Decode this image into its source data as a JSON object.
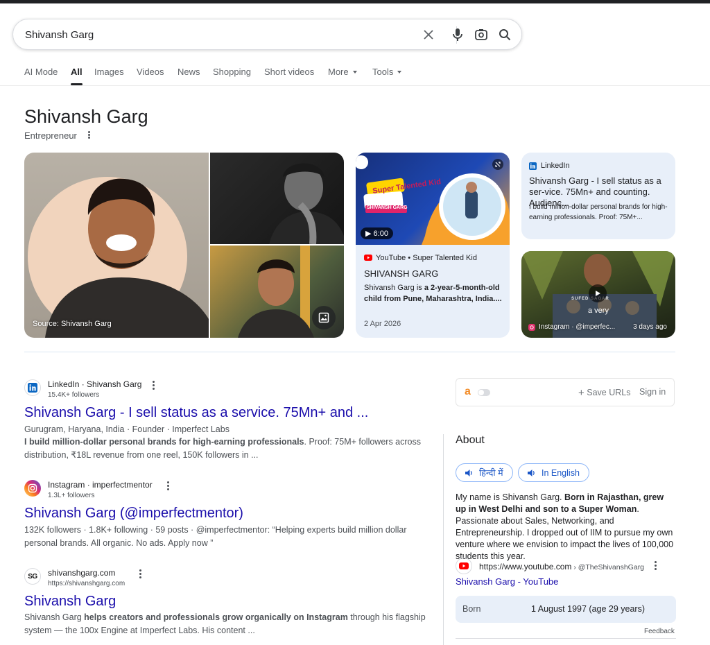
{
  "search": {
    "query": "Shivansh Garg",
    "icons": [
      "close-icon",
      "mic-icon",
      "lens-icon",
      "search-icon"
    ]
  },
  "tabs": [
    {
      "label": "AI Mode"
    },
    {
      "label": "All",
      "active": true
    },
    {
      "label": "Images"
    },
    {
      "label": "Videos"
    },
    {
      "label": "News"
    },
    {
      "label": "Shopping"
    },
    {
      "label": "Short videos"
    },
    {
      "label": "More"
    },
    {
      "label": "Tools"
    }
  ],
  "entity": {
    "name": "Shivansh Garg",
    "subtitle": "Entrepreneur",
    "photo_source": "Source: Shivansh Garg"
  },
  "video_card": {
    "thumb_text": "Super Talented Kid",
    "thumb_caption": "SHIVANSH GARG",
    "duration": "6:00",
    "source": "YouTube • Super Talented Kid",
    "title": "SHIVANSH GARG",
    "desc_plain": "Shivansh Garg is ",
    "desc_bold": "a 2-year-5-month-old child from Pune, Maharashtra, India....",
    "date": "2 Apr 2026"
  },
  "linkedin_card": {
    "source": "LinkedIn",
    "title": "Shivansh Garg - I sell status as a ser-vice. 75Mn+ and counting. Audienc...",
    "desc": "I build million-dollar personal brands for high-earning professionals. Proof: 75M+..."
  },
  "instagram_card": {
    "overlay_text": "a very",
    "overlay_text2": "SUFED SAGAR",
    "source": "Instagram · @imperfec...",
    "ago": "3 days ago"
  },
  "results": [
    {
      "site": "LinkedIn · Shivansh Garg",
      "sub": "15.4K+ followers",
      "title": "Shivansh Garg - I sell status as a service. 75Mn+ and ...",
      "meta": "Gurugram, Haryana, India · Founder · Imperfect Labs",
      "snippet_bold": "I build million-dollar personal brands for high-earning professionals",
      "snippet_rest": ". Proof: 75M+ followers across distribution, ₹18L revenue from one reel, 150K followers in ..."
    },
    {
      "site": "Instagram · imperfectmentor",
      "sub": "1.3L+ followers",
      "title": "Shivansh Garg (@imperfectmentor)",
      "snippet": "132K followers · 1.8K+ following · 59 posts · @imperfectmentor: “Helping experts build million dollar personal brands. All organic. No ads. Apply now ”"
    },
    {
      "site": "shivanshgarg.com",
      "sub": "https://shivanshgarg.com",
      "favicon_text": "SG",
      "title": "Shivansh Garg",
      "snippet_a": "Shivansh Garg ",
      "snippet_b": "helps creators and professionals grow organically on Instagram",
      "snippet_c": " through his flagship system — the 100x Engine at Imperfect Labs. His content ..."
    }
  ],
  "extension": {
    "logo": "a",
    "save": "Save URLs",
    "signin": "Sign in"
  },
  "about": {
    "heading": "About",
    "lang_hindi": "हिन्दी में",
    "lang_english": "In English",
    "t1": "My name is Shivansh Garg. ",
    "t2": "Born in Rajasthan, grew up in West Delhi and son to a Super Woman",
    "t3": ". Passionate about Sales, Networking, and Entrepreneurship. I dropped out of IIM to pursue my own venture where we envision to impact the lives of 100,000 students this year.",
    "url": "https://www.youtube.com",
    "url_path": " › @TheShivanshGarg",
    "link": "Shivansh Garg - YouTube",
    "born_label": "Born",
    "born_value": "1 August 1997 (age 29 years)",
    "feedback": "Feedback"
  },
  "colors": {
    "link": "#1a0dab",
    "card_bg": "#e8eff9",
    "youtube_red": "#ff0000",
    "linkedin_blue": "#0a66c2"
  }
}
